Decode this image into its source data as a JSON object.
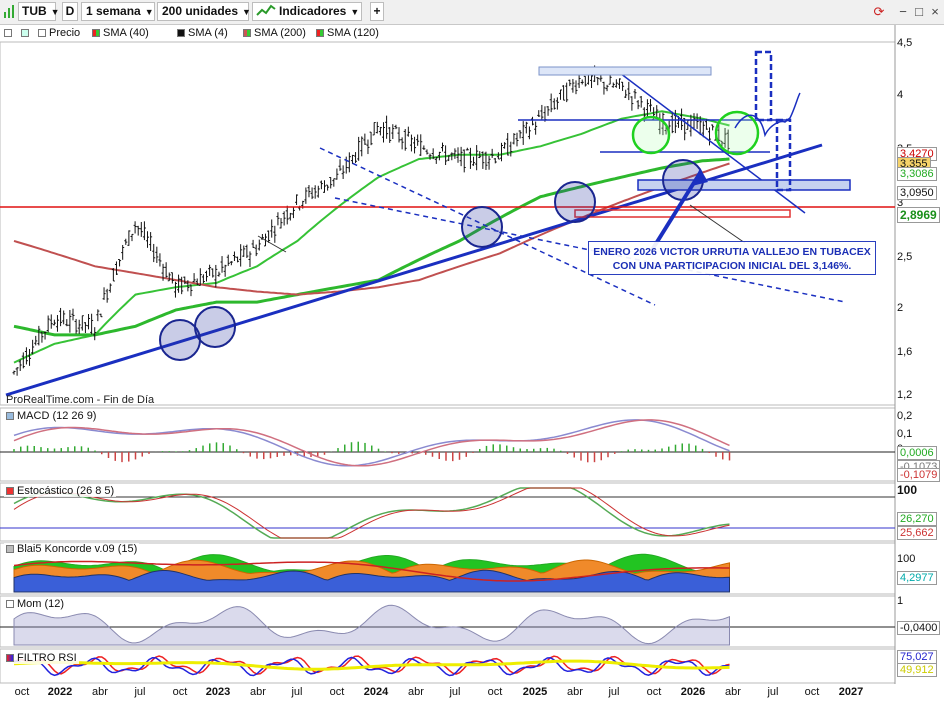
{
  "toolbar": {
    "ticker": "TUB",
    "d_button": "D",
    "period": "1 semana",
    "units": "200 unidades",
    "indicators": "Indicadores"
  },
  "legend": {
    "price": "Precio",
    "sma40": "SMA (40)",
    "sma4": "SMA (4)",
    "sma200": "SMA (200)",
    "sma120": "SMA (120)"
  },
  "source": "ProRealTime.com - Fin de Día",
  "note": {
    "line1": "ENERO 2026 VICTOR URRUTIA VALLEJO EN TUBACEX",
    "line2": "CON UNA PARTICIPACION INICIAL DEL 3,146%."
  },
  "price_axis": [
    "4,5",
    "4",
    "3,5",
    "3",
    "2,5",
    "2",
    "1,6",
    "1,2"
  ],
  "price_tags": [
    "3,4270",
    "3,355",
    "3,3086",
    "3,0950",
    "2,8969"
  ],
  "panels": {
    "macd": {
      "label": "MACD (12 26 9)",
      "axis": [
        "0,2",
        "0,1",
        "0"
      ],
      "tags": [
        "0,0006",
        "-0,1073",
        "-0,1079"
      ]
    },
    "stoch": {
      "label": "Estocástico (26 8 5)",
      "axis": [
        "100"
      ],
      "tags": [
        "26,270",
        "25,662"
      ]
    },
    "koncorde": {
      "label": "Blai5 Koncorde v.09 (15)",
      "axis": [
        "100"
      ],
      "tags": [
        "4,2977"
      ]
    },
    "mom": {
      "label": "Mom (12)",
      "axis": [
        "1"
      ],
      "tags": [
        "-0,0400"
      ]
    },
    "rsi": {
      "label": "FILTRO RSI",
      "axis": [],
      "tags": [
        "75,027",
        "49,912"
      ]
    }
  },
  "x_axis": [
    "oct",
    "2022",
    "abr",
    "jul",
    "oct",
    "2023",
    "abr",
    "jul",
    "oct",
    "2024",
    "abr",
    "jul",
    "oct",
    "2025",
    "abr",
    "jul",
    "oct",
    "2026",
    "abr",
    "jul",
    "oct",
    "2027"
  ],
  "colors": {
    "sma40": "#36c236",
    "sma4": "#111111",
    "sma200": "#c05050",
    "sma120": "#2db82d",
    "trend": "#1a2fc0",
    "resistance": "#e01010"
  },
  "chart_data": {
    "type": "line",
    "title": "TUB",
    "x": [
      "2021-10",
      "2022-01",
      "2022-04",
      "2022-07",
      "2022-10",
      "2023-01",
      "2023-04",
      "2023-07",
      "2023-10",
      "2024-01",
      "2024-04",
      "2024-07",
      "2024-10",
      "2025-01",
      "2025-04",
      "2025-07",
      "2025-10",
      "2026-01",
      "2026-03"
    ],
    "series": [
      {
        "name": "Precio",
        "values": [
          1.25,
          1.55,
          1.5,
          2.25,
          1.75,
          1.85,
          2.05,
          2.45,
          2.7,
          3.3,
          3.05,
          2.9,
          2.95,
          3.4,
          4.0,
          3.85,
          3.35,
          3.3,
          3.1
        ]
      },
      {
        "name": "SMA (40)",
        "values": [
          1.3,
          1.4,
          1.45,
          1.7,
          1.75,
          1.78,
          1.9,
          2.1,
          2.4,
          2.7,
          2.9,
          2.95,
          2.95,
          3.05,
          3.2,
          3.4,
          3.5,
          3.4,
          3.31
        ]
      },
      {
        "name": "SMA (120)",
        "values": [
          1.5,
          1.45,
          1.45,
          1.5,
          1.6,
          1.65,
          1.65,
          1.7,
          1.75,
          1.8,
          1.95,
          2.1,
          2.3,
          2.5,
          2.6,
          2.7,
          2.8,
          2.88,
          2.9
        ]
      },
      {
        "name": "SMA (200)",
        "values": [
          2.1,
          2.0,
          1.9,
          1.85,
          1.8,
          1.75,
          1.72,
          1.7,
          1.72,
          1.75,
          1.8,
          1.9,
          2.0,
          2.15,
          2.3,
          2.45,
          2.6,
          2.75,
          2.85
        ]
      }
    ],
    "ylabel": "",
    "ylim": [
      1.1,
      4.6
    ],
    "log_scale": true,
    "grid": false,
    "legend": "top-left"
  }
}
